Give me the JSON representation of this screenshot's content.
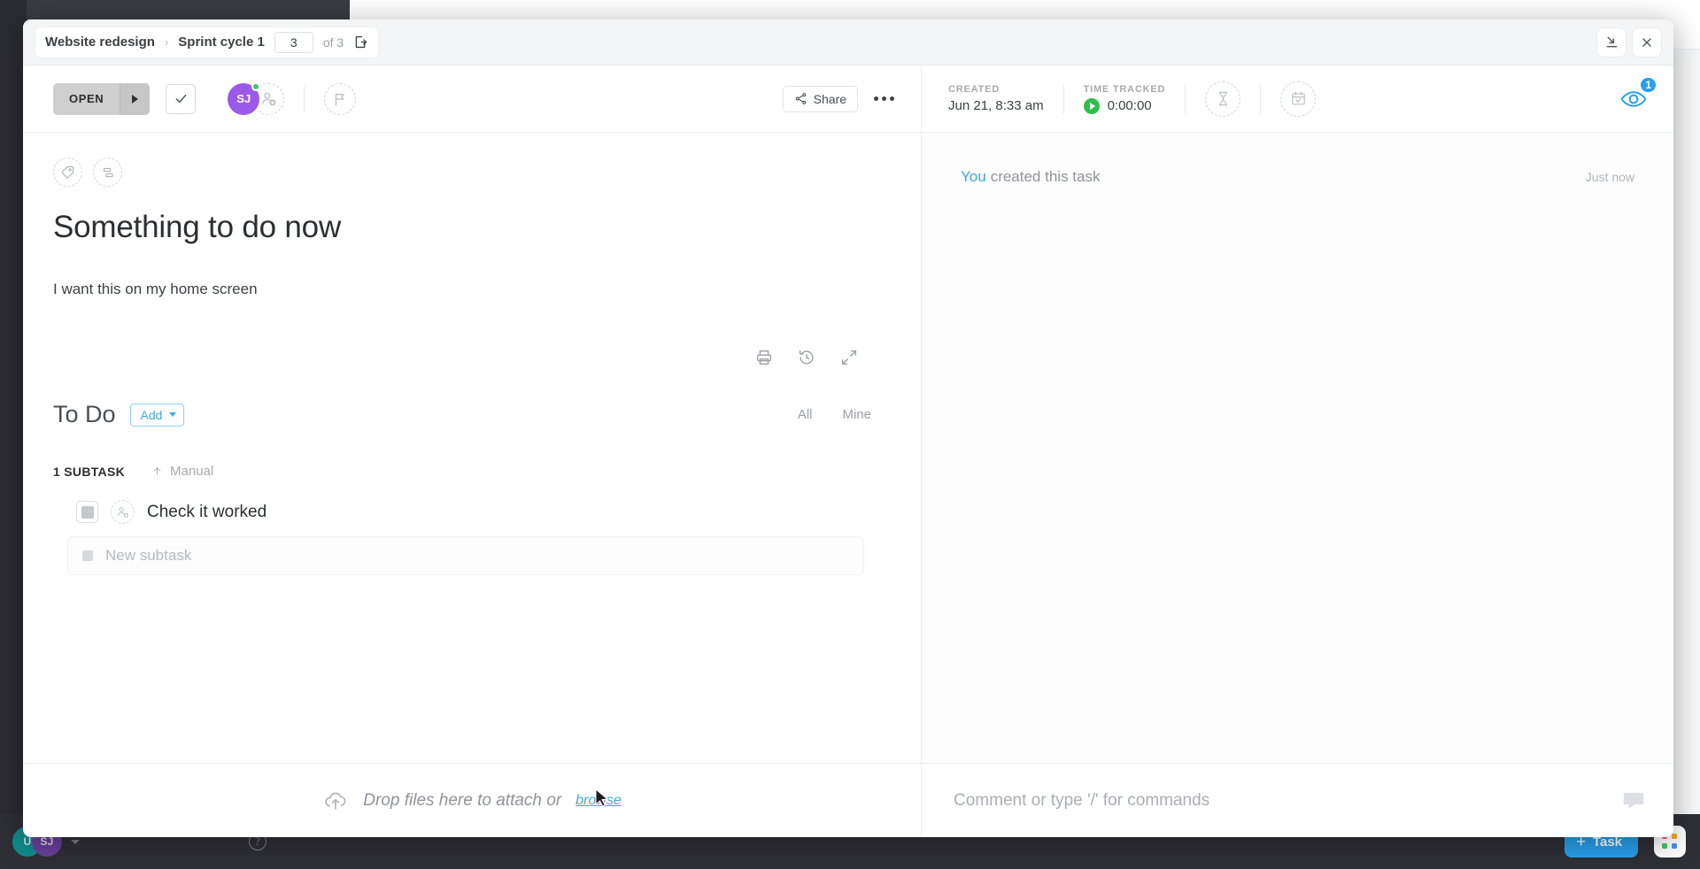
{
  "background": {
    "footer": {
      "avatar_primary": "U",
      "avatar_secondary": "SJ",
      "help_icon": "question-mark-icon",
      "task_button": "Task",
      "plus": "+",
      "apps_icon": "apps-grid-icon"
    }
  },
  "modal": {
    "topbar": {
      "breadcrumb": {
        "space": "Website redesign",
        "separator": "›",
        "list": "Sprint cycle 1"
      },
      "page_current": "3",
      "page_total": "of 3",
      "open_in_new_icon": "open-in-new-icon",
      "collapse_icon": "collapse-to-corner-icon",
      "close_icon": "close-icon"
    },
    "header": {
      "status": "OPEN",
      "status_caret_icon": "chevron-right-icon",
      "resolve_icon": "checkmark-icon",
      "assignee_initials": "SJ",
      "add_assignee_icon": "add-person-icon",
      "priority_icon": "flag-icon",
      "share_label": "Share",
      "share_icon": "share-icon",
      "more_icon": "ellipsis-icon"
    },
    "meta": {
      "created_label": "CREATED",
      "created_value": "Jun 21, 8:33 am",
      "time_tracked_label": "TIME TRACKED",
      "time_tracked_value": "0:00:00",
      "play_icon": "play-icon",
      "estimate_icon": "hourglass-icon",
      "due_date_icon": "calendar-check-icon",
      "watch_icon": "eye-icon",
      "watch_count": "1"
    },
    "content": {
      "tag_icon": "tag-icon",
      "custom_fields_icon": "custom-fields-icon",
      "title": "Something to do now",
      "description": "I want this on my home screen",
      "tools": {
        "print_icon": "print-icon",
        "history_icon": "history-clock-icon",
        "expand_icon": "expand-diagonal-icon"
      },
      "todo": {
        "heading": "To Do",
        "add_label": "Add",
        "add_caret_icon": "chevron-down-icon",
        "filters": [
          "All",
          "Mine"
        ]
      },
      "subtasks": {
        "count_label": "1 SUBTASK",
        "sort_icon": "arrow-up-icon",
        "sort_label": "Manual",
        "items": [
          {
            "name": "Check it worked",
            "checkbox_icon": "checkbox-unchecked-icon",
            "assignee_icon": "add-person-icon"
          }
        ],
        "new_placeholder": "New subtask"
      }
    },
    "attach": {
      "icon": "cloud-upload-icon",
      "text": "Drop files here to attach or",
      "link": "browse",
      "cursor_icon": "mouse-pointer-icon"
    },
    "activity": {
      "actor": "You",
      "text": "created this task",
      "time": "Just now"
    },
    "comment": {
      "placeholder": "Comment or type '/' for commands",
      "icon": "comment-bubble-icon"
    }
  },
  "colors": {
    "accent_blue": "#28a0ec",
    "link_blue": "#3aa9e0",
    "avatar_purple": "#9b59e8",
    "online_green": "#2ecc71",
    "play_green": "#2fc04c",
    "status_gray": "#cfcfcf"
  }
}
